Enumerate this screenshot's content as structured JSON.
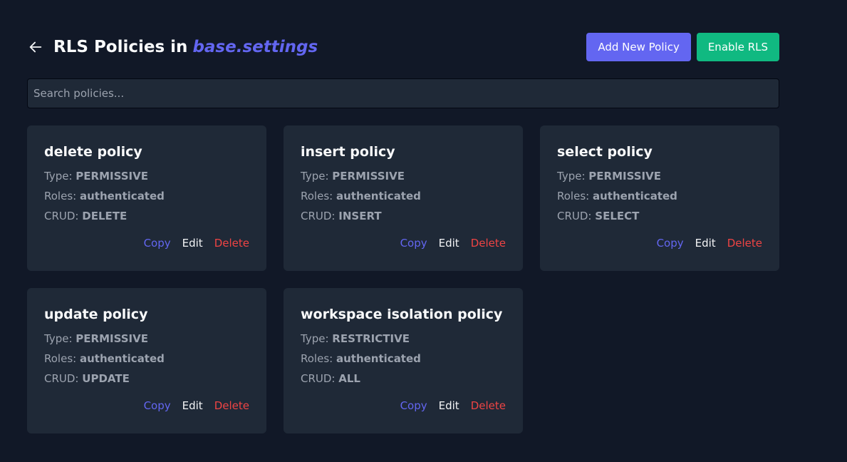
{
  "header": {
    "title_prefix": "RLS Policies in",
    "table_name": "base.settings",
    "back_icon": "arrow-left-icon",
    "add_button_label": "Add New Policy",
    "enable_button_label": "Enable RLS"
  },
  "search": {
    "placeholder": "Search policies...",
    "value": ""
  },
  "labels": {
    "type": "Type:",
    "roles": "Roles:",
    "crud": "CRUD:"
  },
  "card_actions": {
    "copy": "Copy",
    "edit": "Edit",
    "delete": "Delete"
  },
  "policies": [
    {
      "name": "delete policy",
      "type": "PERMISSIVE",
      "roles": "authenticated",
      "crud": "DELETE"
    },
    {
      "name": "insert policy",
      "type": "PERMISSIVE",
      "roles": "authenticated",
      "crud": "INSERT"
    },
    {
      "name": "select policy",
      "type": "PERMISSIVE",
      "roles": "authenticated",
      "crud": "SELECT"
    },
    {
      "name": "update policy",
      "type": "PERMISSIVE",
      "roles": "authenticated",
      "crud": "UPDATE"
    },
    {
      "name": "workspace isolation policy",
      "type": "RESTRICTIVE",
      "roles": "authenticated",
      "crud": "ALL"
    }
  ],
  "colors": {
    "background": "#111827",
    "card": "#1f2937",
    "accent": "#6366f1",
    "success": "#10b981",
    "danger": "#ef4444"
  }
}
